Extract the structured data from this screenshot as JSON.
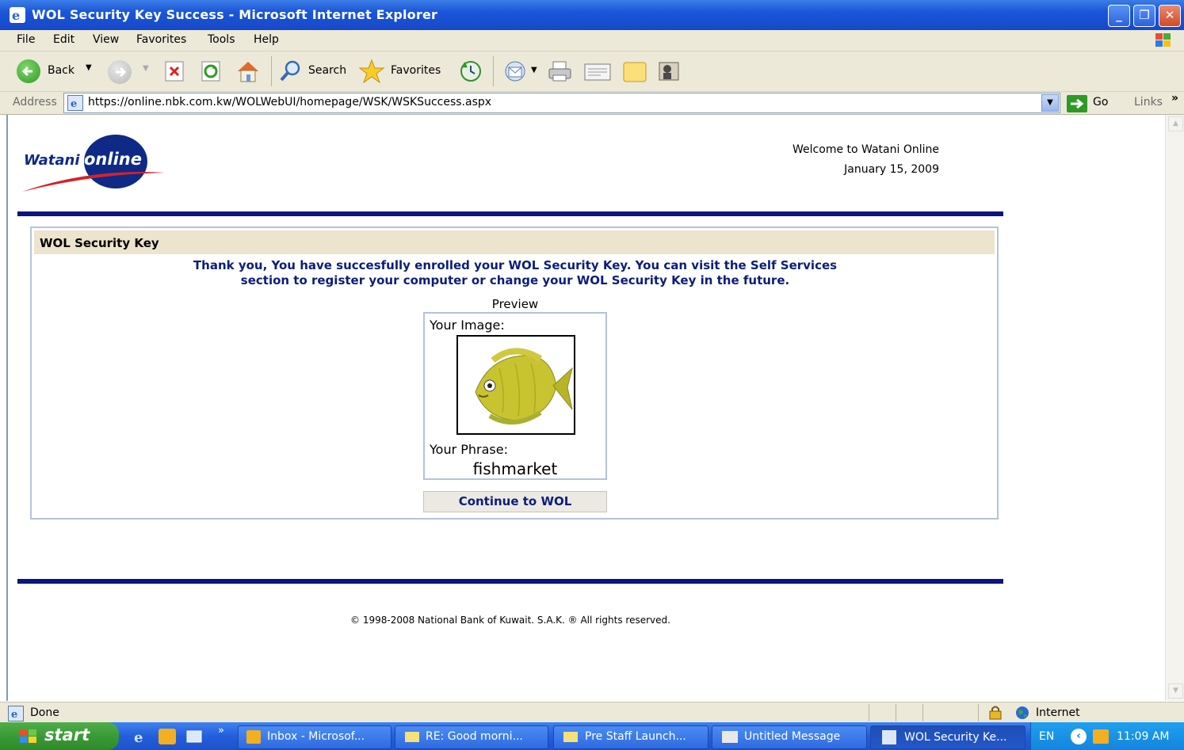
{
  "window": {
    "title": "WOL Security Key Success - Microsoft Internet Explorer",
    "min_glyph": "_",
    "max_glyph": "❐",
    "close_glyph": "✕"
  },
  "menu": [
    "File",
    "Edit",
    "View",
    "Favorites",
    "Tools",
    "Help"
  ],
  "toolbar": {
    "back": "Back",
    "search": "Search",
    "favorites": "Favorites"
  },
  "address": {
    "label": "Address",
    "url": "https://online.nbk.com.kw/WOLWebUI/homepage/WSK/WSKSuccess.aspx",
    "go": "Go",
    "links": "Links",
    "links_chevron": "»"
  },
  "page": {
    "logo_watani": "Watani",
    "logo_online": "online",
    "welcome": "Welcome to Watani Online",
    "date": "January 15, 2009",
    "panel_title": "WOL Security Key",
    "message_line1": "Thank you, You have succesfully enrolled your WOL Security Key. You can visit the Self Services",
    "message_line2": "section to register your computer or change your WOL Security Key in the future.",
    "preview_label": "Preview",
    "your_image_label": "Your Image:",
    "your_phrase_label": "Your Phrase:",
    "phrase": "fishmarket",
    "continue_button": "Continue to WOL",
    "footer": "© 1998-2008 National Bank of Kuwait. S.A.K. ® All rights reserved."
  },
  "status": {
    "text": "Done",
    "zone": "Internet"
  },
  "taskbar": {
    "start": "start",
    "chevron": "»",
    "tasks": [
      "Inbox - Microsof...",
      "RE: Good morni...",
      "Pre Staff Launch...",
      "Untitled Message",
      "WOL Security Ke..."
    ],
    "lang": "EN",
    "clock": "11:09 AM"
  },
  "colors": {
    "rule": "#0c1480",
    "panel_header": "#ece4cc",
    "accent_blue": "#0c1d7a",
    "logo_red": "#d4222a"
  }
}
